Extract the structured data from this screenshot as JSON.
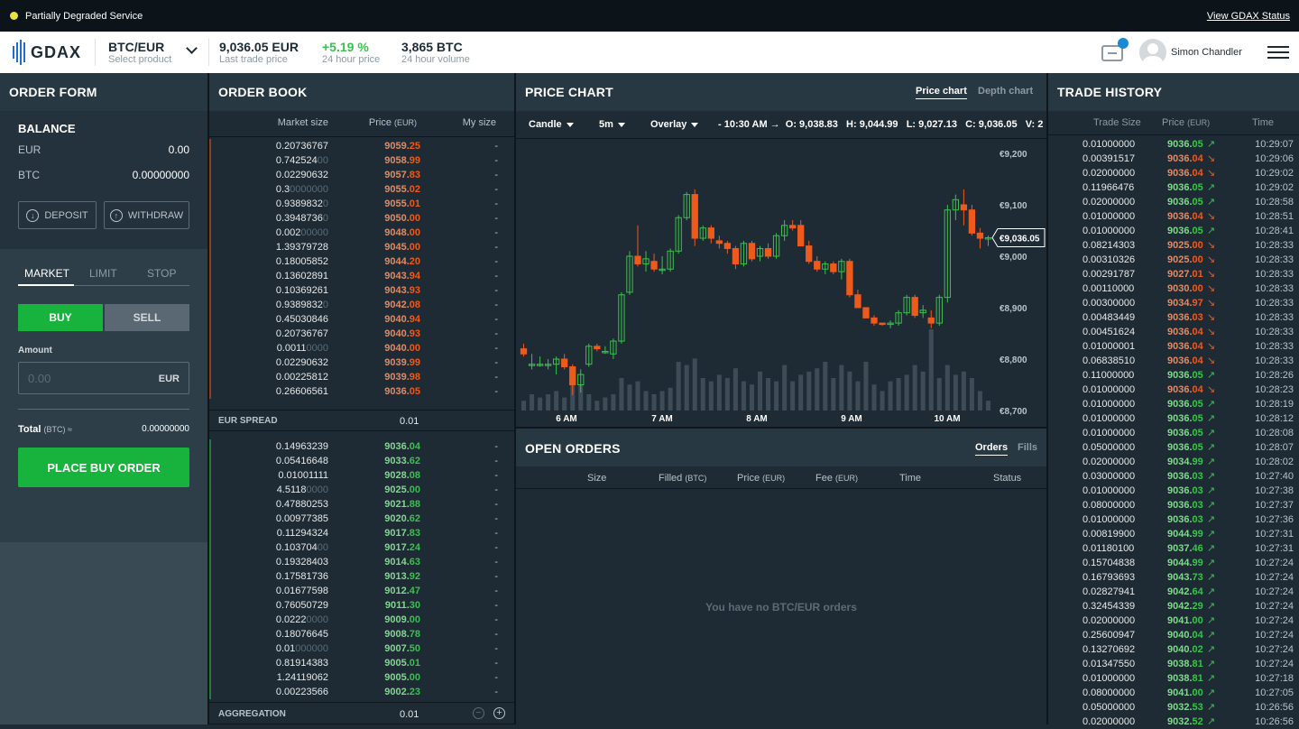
{
  "status_bar": {
    "message": "Partially Degraded Service",
    "link": "View GDAX Status"
  },
  "header": {
    "logo": "GDAX",
    "pair": "BTC/EUR",
    "pair_sub": "Select product",
    "last_price": "9,036.05 EUR",
    "last_price_label": "Last trade price",
    "change": "+5.19 %",
    "change_label": "24 hour price",
    "volume": "3,865 BTC",
    "volume_label": "24 hour volume",
    "user_name": "Simon Chandler"
  },
  "order_form": {
    "title": "ORDER FORM",
    "balance_title": "BALANCE",
    "eur_label": "EUR",
    "eur_value": "0.00",
    "btc_label": "BTC",
    "btc_value": "0.00000000",
    "deposit": "DEPOSIT",
    "withdraw": "WITHDRAW",
    "tabs": [
      "MARKET",
      "LIMIT",
      "STOP"
    ],
    "buy": "BUY",
    "sell": "SELL",
    "amount_label": "Amount",
    "amount_placeholder": "0.00",
    "amount_unit": "EUR",
    "total_label": "Total",
    "total_unit": "(BTC) ≈",
    "total_value": "0.00000000",
    "place_order": "PLACE BUY ORDER"
  },
  "order_book": {
    "title": "ORDER BOOK",
    "col_market_size": "Market size",
    "col_price": "Price",
    "col_price_unit": "(EUR)",
    "col_my_size": "My size",
    "asks": [
      {
        "s": "0.20736767",
        "d": "",
        "p1": "9059.",
        "p2": "25",
        "m": "-"
      },
      {
        "s": "0.742524",
        "d": "00",
        "p1": "9058.",
        "p2": "99",
        "m": "-"
      },
      {
        "s": "0.02290632",
        "d": "",
        "p1": "9057.",
        "p2": "83",
        "m": "-"
      },
      {
        "s": "0.3",
        "d": "0000000",
        "p1": "9055.",
        "p2": "02",
        "m": "-"
      },
      {
        "s": "0.9389832",
        "d": "0",
        "p1": "9055.",
        "p2": "01",
        "m": "-"
      },
      {
        "s": "0.3948736",
        "d": "0",
        "p1": "9050.",
        "p2": "00",
        "m": "-"
      },
      {
        "s": "0.002",
        "d": "00000",
        "p1": "9048.",
        "p2": "00",
        "m": "-"
      },
      {
        "s": "1.39379728",
        "d": "",
        "p1": "9045.",
        "p2": "00",
        "m": "-"
      },
      {
        "s": "0.18005852",
        "d": "",
        "p1": "9044.",
        "p2": "20",
        "m": "-"
      },
      {
        "s": "0.13602891",
        "d": "",
        "p1": "9043.",
        "p2": "94",
        "m": "-"
      },
      {
        "s": "0.10369261",
        "d": "",
        "p1": "9043.",
        "p2": "93",
        "m": "-"
      },
      {
        "s": "0.9389832",
        "d": "0",
        "p1": "9042.",
        "p2": "08",
        "m": "-"
      },
      {
        "s": "0.45030846",
        "d": "",
        "p1": "9040.",
        "p2": "94",
        "m": "-"
      },
      {
        "s": "0.20736767",
        "d": "",
        "p1": "9040.",
        "p2": "93",
        "m": "-"
      },
      {
        "s": "0.0011",
        "d": "0000",
        "p1": "9040.",
        "p2": "00",
        "m": "-"
      },
      {
        "s": "0.02290632",
        "d": "",
        "p1": "9039.",
        "p2": "99",
        "m": "-"
      },
      {
        "s": "0.00225812",
        "d": "",
        "p1": "9039.",
        "p2": "98",
        "m": "-"
      },
      {
        "s": "0.26606561",
        "d": "",
        "p1": "9036.",
        "p2": "05",
        "m": "-"
      }
    ],
    "spread_label": "EUR SPREAD",
    "spread_value": "0.01",
    "bids": [
      {
        "s": "0.14963239",
        "d": "",
        "p1": "9036.",
        "p2": "04",
        "m": "-"
      },
      {
        "s": "0.05416648",
        "d": "",
        "p1": "9033.",
        "p2": "62",
        "m": "-"
      },
      {
        "s": "0.01001111",
        "d": "",
        "p1": "9028.",
        "p2": "08",
        "m": "-"
      },
      {
        "s": "4.5118",
        "d": "0000",
        "p1": "9025.",
        "p2": "00",
        "m": "-"
      },
      {
        "s": "0.47880253",
        "d": "",
        "p1": "9021.",
        "p2": "88",
        "m": "-"
      },
      {
        "s": "0.00977385",
        "d": "",
        "p1": "9020.",
        "p2": "62",
        "m": "-"
      },
      {
        "s": "0.11294324",
        "d": "",
        "p1": "9017.",
        "p2": "83",
        "m": "-"
      },
      {
        "s": "0.103704",
        "d": "00",
        "p1": "9017.",
        "p2": "24",
        "m": "-"
      },
      {
        "s": "0.19328403",
        "d": "",
        "p1": "9014.",
        "p2": "63",
        "m": "-"
      },
      {
        "s": "0.17581736",
        "d": "",
        "p1": "9013.",
        "p2": "92",
        "m": "-"
      },
      {
        "s": "0.01677598",
        "d": "",
        "p1": "9012.",
        "p2": "47",
        "m": "-"
      },
      {
        "s": "0.76050729",
        "d": "",
        "p1": "9011.",
        "p2": "30",
        "m": "-"
      },
      {
        "s": "0.0222",
        "d": "0000",
        "p1": "9009.",
        "p2": "00",
        "m": "-"
      },
      {
        "s": "0.18076645",
        "d": "",
        "p1": "9008.",
        "p2": "78",
        "m": "-"
      },
      {
        "s": "0.01",
        "d": "000000",
        "p1": "9007.",
        "p2": "50",
        "m": "-"
      },
      {
        "s": "0.81914383",
        "d": "",
        "p1": "9005.",
        "p2": "01",
        "m": "-"
      },
      {
        "s": "1.24119062",
        "d": "",
        "p1": "9005.",
        "p2": "00",
        "m": "-"
      },
      {
        "s": "0.00223566",
        "d": "",
        "p1": "9002.",
        "p2": "23",
        "m": "-"
      }
    ],
    "aggregation_label": "AGGREGATION",
    "aggregation_value": "0.01"
  },
  "price_chart": {
    "title": "PRICE CHART",
    "tab_price": "Price chart",
    "tab_depth": "Depth chart",
    "type_select": "Candle",
    "interval_select": "5m",
    "overlay_select": "Overlay",
    "ohlc": "- 10:30 AM →  O: 9,038.83   H: 9,044.99   L: 9,027.13   C: 9,036.05   V: 2",
    "price_tag": "€9,036.05",
    "y_ticks": [
      "€9,200",
      "€9,100",
      "€9,000",
      "€8,900",
      "€8,800",
      "€8,700"
    ],
    "x_ticks": [
      "6 AM",
      "7 AM",
      "8 AM",
      "9 AM",
      "10 AM"
    ],
    "colors": {
      "up": "#39c24d",
      "down": "#ee5a1c",
      "volume": "#3d4c57"
    }
  },
  "chart_data": {
    "type": "candlestick",
    "x_labels": [
      "6 AM",
      "7 AM",
      "8 AM",
      "9 AM",
      "10 AM"
    ],
    "ylim": [
      8700,
      9200
    ],
    "candles": [
      [
        8820,
        8830,
        8805,
        8810
      ],
      [
        8790,
        8810,
        8780,
        8790
      ],
      [
        8790,
        8805,
        8785,
        8790
      ],
      [
        8790,
        8800,
        8780,
        8790
      ],
      [
        8790,
        8805,
        8770,
        8800
      ],
      [
        8800,
        8810,
        8780,
        8785
      ],
      [
        8785,
        8790,
        8730,
        8750
      ],
      [
        8750,
        8780,
        8735,
        8770
      ],
      [
        8790,
        8830,
        8785,
        8825
      ],
      [
        8825,
        8830,
        8815,
        8820
      ],
      [
        8815,
        8825,
        8810,
        8815
      ],
      [
        8810,
        8840,
        8800,
        8835
      ],
      [
        8835,
        8930,
        8830,
        8925
      ],
      [
        8930,
        9010,
        8925,
        9000
      ],
      [
        9000,
        9060,
        8980,
        8985
      ],
      [
        8985,
        9010,
        8970,
        8995
      ],
      [
        8990,
        9005,
        8970,
        8975
      ],
      [
        8975,
        9000,
        8965,
        8975
      ],
      [
        8975,
        9015,
        8970,
        9010
      ],
      [
        9010,
        9080,
        9005,
        9075
      ],
      [
        9075,
        9125,
        9070,
        9120
      ],
      [
        9120,
        9130,
        9020,
        9035
      ],
      [
        9035,
        9060,
        9030,
        9055
      ],
      [
        9055,
        9060,
        9025,
        9035
      ],
      [
        9030,
        9040,
        9015,
        9025
      ],
      [
        9025,
        9030,
        9005,
        9015
      ],
      [
        9015,
        9020,
        8975,
        8985
      ],
      [
        8985,
        9030,
        8980,
        9025
      ],
      [
        9025,
        9030,
        8990,
        8995
      ],
      [
        9000,
        9020,
        8990,
        9015
      ],
      [
        9015,
        9025,
        8995,
        9000
      ],
      [
        9000,
        9045,
        8995,
        9040
      ],
      [
        9040,
        9070,
        9030,
        9060
      ],
      [
        9060,
        9070,
        9050,
        9055
      ],
      [
        9060,
        9070,
        9040,
        9020
      ],
      [
        9020,
        9030,
        8985,
        8990
      ],
      [
        8990,
        9000,
        8970,
        8975
      ],
      [
        8975,
        8990,
        8965,
        8985
      ],
      [
        8985,
        8990,
        8965,
        8970
      ],
      [
        8970,
        8995,
        8955,
        8990
      ],
      [
        8990,
        8995,
        8920,
        8925
      ],
      [
        8925,
        8935,
        8900,
        8900
      ],
      [
        8900,
        8900,
        8880,
        8880
      ],
      [
        8880,
        8885,
        8865,
        8870
      ],
      [
        8870,
        8870,
        8865,
        8868
      ],
      [
        8868,
        8875,
        8860,
        8870
      ],
      [
        8870,
        8895,
        8865,
        8890
      ],
      [
        8890,
        8925,
        8885,
        8920
      ],
      [
        8920,
        8925,
        8880,
        8885
      ],
      [
        8890,
        8905,
        8880,
        8895
      ],
      [
        8880,
        8895,
        8860,
        8870
      ],
      [
        8870,
        8925,
        8865,
        8920
      ],
      [
        8920,
        9100,
        8910,
        9090
      ],
      [
        9090,
        9120,
        9070,
        9110
      ],
      [
        9100,
        9130,
        9060,
        9090
      ],
      [
        9090,
        9100,
        9040,
        9045
      ],
      [
        9045,
        9055,
        9015,
        9035
      ],
      [
        9035,
        9040,
        9020,
        9036.05
      ]
    ],
    "volume": [
      3,
      5,
      4,
      5,
      6,
      4,
      12,
      8,
      5,
      3,
      4,
      5,
      10,
      8,
      9,
      6,
      5,
      6,
      7,
      15,
      14,
      16,
      10,
      9,
      11,
      10,
      13,
      9,
      8,
      12,
      10,
      9,
      14,
      9,
      11,
      12,
      13,
      15,
      10,
      14,
      12,
      9,
      15,
      8,
      6,
      9,
      10,
      11,
      14,
      12,
      25,
      10,
      14,
      11,
      12,
      10,
      6,
      3
    ]
  },
  "open_orders": {
    "title": "OPEN ORDERS",
    "tab_orders": "Orders",
    "tab_fills": "Fills",
    "cols": {
      "size": "Size",
      "filled": "Filled",
      "filled_unit": "(BTC)",
      "price": "Price",
      "price_unit": "(EUR)",
      "fee": "Fee",
      "fee_unit": "(EUR)",
      "time": "Time",
      "status": "Status"
    },
    "empty": "You have no BTC/EUR orders"
  },
  "trade_history": {
    "title": "TRADE HISTORY",
    "col_size": "Trade Size",
    "col_price": "Price",
    "col_price_unit": "(EUR)",
    "col_time": "Time",
    "trades": [
      {
        "s": "0.01000000",
        "p1": "9036.",
        "p2": "05",
        "u": true,
        "t": "10:29:07"
      },
      {
        "s": "0.00391517",
        "p1": "9036.",
        "p2": "04",
        "u": false,
        "t": "10:29:06"
      },
      {
        "s": "0.02000000",
        "p1": "9036.",
        "p2": "04",
        "u": false,
        "t": "10:29:02"
      },
      {
        "s": "0.11966476",
        "p1": "9036.",
        "p2": "05",
        "u": true,
        "t": "10:29:02"
      },
      {
        "s": "0.02000000",
        "p1": "9036.",
        "p2": "05",
        "u": true,
        "t": "10:28:58"
      },
      {
        "s": "0.01000000",
        "p1": "9036.",
        "p2": "04",
        "u": false,
        "t": "10:28:51"
      },
      {
        "s": "0.01000000",
        "p1": "9036.",
        "p2": "05",
        "u": true,
        "t": "10:28:41"
      },
      {
        "s": "0.08214303",
        "p1": "9025.",
        "p2": "00",
        "u": false,
        "t": "10:28:33"
      },
      {
        "s": "0.00310326",
        "p1": "9025.",
        "p2": "00",
        "u": false,
        "t": "10:28:33"
      },
      {
        "s": "0.00291787",
        "p1": "9027.",
        "p2": "01",
        "u": false,
        "t": "10:28:33"
      },
      {
        "s": "0.00110000",
        "p1": "9030.",
        "p2": "00",
        "u": false,
        "t": "10:28:33"
      },
      {
        "s": "0.00300000",
        "p1": "9034.",
        "p2": "97",
        "u": false,
        "t": "10:28:33"
      },
      {
        "s": "0.00483449",
        "p1": "9036.",
        "p2": "03",
        "u": false,
        "t": "10:28:33"
      },
      {
        "s": "0.00451624",
        "p1": "9036.",
        "p2": "04",
        "u": false,
        "t": "10:28:33"
      },
      {
        "s": "0.01000001",
        "p1": "9036.",
        "p2": "04",
        "u": false,
        "t": "10:28:33"
      },
      {
        "s": "0.06838510",
        "p1": "9036.",
        "p2": "04",
        "u": false,
        "t": "10:28:33"
      },
      {
        "s": "0.11000000",
        "p1": "9036.",
        "p2": "05",
        "u": true,
        "t": "10:28:26"
      },
      {
        "s": "0.01000000",
        "p1": "9036.",
        "p2": "04",
        "u": false,
        "t": "10:28:23"
      },
      {
        "s": "0.01000000",
        "p1": "9036.",
        "p2": "05",
        "u": true,
        "t": "10:28:19"
      },
      {
        "s": "0.01000000",
        "p1": "9036.",
        "p2": "05",
        "u": true,
        "t": "10:28:12"
      },
      {
        "s": "0.01000000",
        "p1": "9036.",
        "p2": "05",
        "u": true,
        "t": "10:28:08"
      },
      {
        "s": "0.05000000",
        "p1": "9036.",
        "p2": "05",
        "u": true,
        "t": "10:28:07"
      },
      {
        "s": "0.02000000",
        "p1": "9034.",
        "p2": "99",
        "u": true,
        "t": "10:28:02"
      },
      {
        "s": "0.03000000",
        "p1": "9036.",
        "p2": "03",
        "u": true,
        "t": "10:27:40"
      },
      {
        "s": "0.01000000",
        "p1": "9036.",
        "p2": "03",
        "u": true,
        "t": "10:27:38"
      },
      {
        "s": "0.08000000",
        "p1": "9036.",
        "p2": "03",
        "u": true,
        "t": "10:27:37"
      },
      {
        "s": "0.01000000",
        "p1": "9036.",
        "p2": "03",
        "u": true,
        "t": "10:27:36"
      },
      {
        "s": "0.00819900",
        "p1": "9044.",
        "p2": "99",
        "u": true,
        "t": "10:27:31"
      },
      {
        "s": "0.01180100",
        "p1": "9037.",
        "p2": "46",
        "u": true,
        "t": "10:27:31"
      },
      {
        "s": "0.15704838",
        "p1": "9044.",
        "p2": "99",
        "u": true,
        "t": "10:27:24"
      },
      {
        "s": "0.16793693",
        "p1": "9043.",
        "p2": "73",
        "u": true,
        "t": "10:27:24"
      },
      {
        "s": "0.02827941",
        "p1": "9042.",
        "p2": "64",
        "u": true,
        "t": "10:27:24"
      },
      {
        "s": "0.32454339",
        "p1": "9042.",
        "p2": "29",
        "u": true,
        "t": "10:27:24"
      },
      {
        "s": "0.02000000",
        "p1": "9041.",
        "p2": "00",
        "u": true,
        "t": "10:27:24"
      },
      {
        "s": "0.25600947",
        "p1": "9040.",
        "p2": "04",
        "u": true,
        "t": "10:27:24"
      },
      {
        "s": "0.13270692",
        "p1": "9040.",
        "p2": "02",
        "u": true,
        "t": "10:27:24"
      },
      {
        "s": "0.01347550",
        "p1": "9038.",
        "p2": "81",
        "u": true,
        "t": "10:27:24"
      },
      {
        "s": "0.01000000",
        "p1": "9038.",
        "p2": "81",
        "u": true,
        "t": "10:27:18"
      },
      {
        "s": "0.08000000",
        "p1": "9041.",
        "p2": "00",
        "u": true,
        "t": "10:27:05"
      },
      {
        "s": "0.05000000",
        "p1": "9032.",
        "p2": "53",
        "u": true,
        "t": "10:26:56"
      },
      {
        "s": "0.02000000",
        "p1": "9032.",
        "p2": "52",
        "u": true,
        "t": "10:26:56"
      }
    ]
  }
}
